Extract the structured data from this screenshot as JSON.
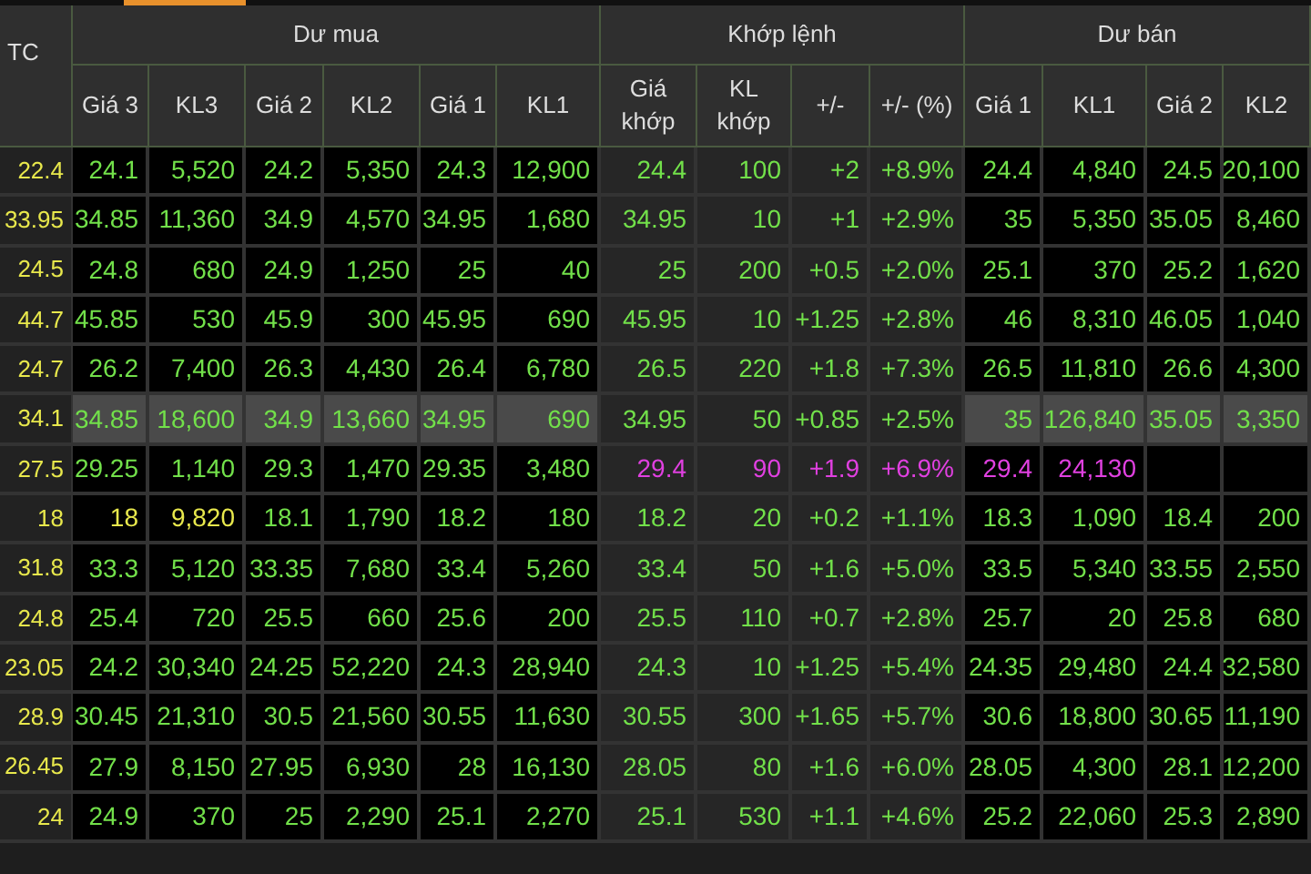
{
  "tc_header": "TC",
  "groups": [
    {
      "label": "Dư mua",
      "columns": [
        "Giá 3",
        "KL3",
        "Giá 2",
        "KL2",
        "Giá 1",
        "KL1"
      ]
    },
    {
      "label": "Khớp lệnh",
      "columns": [
        "Giá khớp",
        "KL khớp",
        "+/-",
        "+/- (%)"
      ]
    },
    {
      "label": "Dư bán",
      "columns": [
        "Giá 1",
        "KL1",
        "Giá 2",
        "KL2"
      ]
    }
  ],
  "rows": [
    {
      "tc": "22.4",
      "selected": false,
      "cells": [
        {
          "text": "24.1",
          "color": "#72e04a"
        },
        {
          "text": "5,520",
          "color": "#72e04a"
        },
        {
          "text": "24.2",
          "color": "#72e04a"
        },
        {
          "text": "5,350",
          "color": "#72e04a"
        },
        {
          "text": "24.3",
          "color": "#72e04a"
        },
        {
          "text": "12,900",
          "color": "#72e04a"
        },
        {
          "text": "24.4",
          "color": "#72e04a"
        },
        {
          "text": "100",
          "color": "#72e04a"
        },
        {
          "text": "+2",
          "color": "#72e04a"
        },
        {
          "text": "+8.9%",
          "color": "#72e04a"
        },
        {
          "text": "24.4",
          "color": "#72e04a"
        },
        {
          "text": "4,840",
          "color": "#72e04a"
        },
        {
          "text": "24.5",
          "color": "#72e04a"
        },
        {
          "text": "20,100",
          "color": "#72e04a"
        }
      ]
    },
    {
      "tc": "33.95",
      "selected": false,
      "cells": [
        {
          "text": "34.85",
          "color": "#72e04a"
        },
        {
          "text": "11,360",
          "color": "#72e04a"
        },
        {
          "text": "34.9",
          "color": "#72e04a"
        },
        {
          "text": "4,570",
          "color": "#72e04a"
        },
        {
          "text": "34.95",
          "color": "#72e04a"
        },
        {
          "text": "1,680",
          "color": "#72e04a"
        },
        {
          "text": "34.95",
          "color": "#72e04a"
        },
        {
          "text": "10",
          "color": "#72e04a"
        },
        {
          "text": "+1",
          "color": "#72e04a"
        },
        {
          "text": "+2.9%",
          "color": "#72e04a"
        },
        {
          "text": "35",
          "color": "#72e04a"
        },
        {
          "text": "5,350",
          "color": "#72e04a"
        },
        {
          "text": "35.05",
          "color": "#72e04a"
        },
        {
          "text": "8,460",
          "color": "#72e04a"
        }
      ]
    },
    {
      "tc": "24.5",
      "selected": false,
      "cells": [
        {
          "text": "24.8",
          "color": "#72e04a"
        },
        {
          "text": "680",
          "color": "#72e04a"
        },
        {
          "text": "24.9",
          "color": "#72e04a"
        },
        {
          "text": "1,250",
          "color": "#72e04a"
        },
        {
          "text": "25",
          "color": "#72e04a"
        },
        {
          "text": "40",
          "color": "#72e04a"
        },
        {
          "text": "25",
          "color": "#72e04a"
        },
        {
          "text": "200",
          "color": "#72e04a"
        },
        {
          "text": "+0.5",
          "color": "#72e04a"
        },
        {
          "text": "+2.0%",
          "color": "#72e04a"
        },
        {
          "text": "25.1",
          "color": "#72e04a"
        },
        {
          "text": "370",
          "color": "#72e04a"
        },
        {
          "text": "25.2",
          "color": "#72e04a"
        },
        {
          "text": "1,620",
          "color": "#72e04a"
        }
      ]
    },
    {
      "tc": "44.7",
      "selected": false,
      "cells": [
        {
          "text": "45.85",
          "color": "#72e04a"
        },
        {
          "text": "530",
          "color": "#72e04a"
        },
        {
          "text": "45.9",
          "color": "#72e04a"
        },
        {
          "text": "300",
          "color": "#72e04a"
        },
        {
          "text": "45.95",
          "color": "#72e04a"
        },
        {
          "text": "690",
          "color": "#72e04a"
        },
        {
          "text": "45.95",
          "color": "#72e04a"
        },
        {
          "text": "10",
          "color": "#72e04a"
        },
        {
          "text": "+1.25",
          "color": "#72e04a"
        },
        {
          "text": "+2.8%",
          "color": "#72e04a"
        },
        {
          "text": "46",
          "color": "#72e04a"
        },
        {
          "text": "8,310",
          "color": "#72e04a"
        },
        {
          "text": "46.05",
          "color": "#72e04a"
        },
        {
          "text": "1,040",
          "color": "#72e04a"
        }
      ]
    },
    {
      "tc": "24.7",
      "selected": false,
      "cells": [
        {
          "text": "26.2",
          "color": "#72e04a"
        },
        {
          "text": "7,400",
          "color": "#72e04a"
        },
        {
          "text": "26.3",
          "color": "#72e04a"
        },
        {
          "text": "4,430",
          "color": "#72e04a"
        },
        {
          "text": "26.4",
          "color": "#72e04a"
        },
        {
          "text": "6,780",
          "color": "#72e04a"
        },
        {
          "text": "26.5",
          "color": "#72e04a"
        },
        {
          "text": "220",
          "color": "#72e04a"
        },
        {
          "text": "+1.8",
          "color": "#72e04a"
        },
        {
          "text": "+7.3%",
          "color": "#72e04a"
        },
        {
          "text": "26.5",
          "color": "#72e04a"
        },
        {
          "text": "11,810",
          "color": "#72e04a"
        },
        {
          "text": "26.6",
          "color": "#72e04a"
        },
        {
          "text": "4,300",
          "color": "#72e04a"
        }
      ]
    },
    {
      "tc": "34.1",
      "selected": true,
      "cells": [
        {
          "text": "34.85",
          "color": "#72e04a"
        },
        {
          "text": "18,600",
          "color": "#72e04a"
        },
        {
          "text": "34.9",
          "color": "#72e04a"
        },
        {
          "text": "13,660",
          "color": "#72e04a"
        },
        {
          "text": "34.95",
          "color": "#72e04a"
        },
        {
          "text": "690",
          "color": "#72e04a"
        },
        {
          "text": "34.95",
          "color": "#72e04a"
        },
        {
          "text": "50",
          "color": "#72e04a"
        },
        {
          "text": "+0.85",
          "color": "#72e04a"
        },
        {
          "text": "+2.5%",
          "color": "#72e04a"
        },
        {
          "text": "35",
          "color": "#72e04a"
        },
        {
          "text": "126,840",
          "color": "#72e04a"
        },
        {
          "text": "35.05",
          "color": "#72e04a"
        },
        {
          "text": "3,350",
          "color": "#72e04a"
        }
      ]
    },
    {
      "tc": "27.5",
      "selected": false,
      "cells": [
        {
          "text": "29.25",
          "color": "#72e04a"
        },
        {
          "text": "1,140",
          "color": "#72e04a"
        },
        {
          "text": "29.3",
          "color": "#72e04a"
        },
        {
          "text": "1,470",
          "color": "#72e04a"
        },
        {
          "text": "29.35",
          "color": "#72e04a"
        },
        {
          "text": "3,480",
          "color": "#72e04a"
        },
        {
          "text": "29.4",
          "color": "#e040e0"
        },
        {
          "text": "90",
          "color": "#e040e0"
        },
        {
          "text": "+1.9",
          "color": "#e040e0"
        },
        {
          "text": "+6.9%",
          "color": "#e040e0"
        },
        {
          "text": "29.4",
          "color": "#e040e0"
        },
        {
          "text": "24,130",
          "color": "#e040e0"
        }
      ]
    },
    {
      "tc": "18",
      "selected": false,
      "cells": [
        {
          "text": "18",
          "color": "#e8e84c"
        },
        {
          "text": "9,820",
          "color": "#e8e84c"
        },
        {
          "text": "18.1",
          "color": "#72e04a"
        },
        {
          "text": "1,790",
          "color": "#72e04a"
        },
        {
          "text": "18.2",
          "color": "#72e04a"
        },
        {
          "text": "180",
          "color": "#72e04a"
        },
        {
          "text": "18.2",
          "color": "#72e04a"
        },
        {
          "text": "20",
          "color": "#72e04a"
        },
        {
          "text": "+0.2",
          "color": "#72e04a"
        },
        {
          "text": "+1.1%",
          "color": "#72e04a"
        },
        {
          "text": "18.3",
          "color": "#72e04a"
        },
        {
          "text": "1,090",
          "color": "#72e04a"
        },
        {
          "text": "18.4",
          "color": "#72e04a"
        },
        {
          "text": "200",
          "color": "#72e04a"
        }
      ]
    },
    {
      "tc": "31.8",
      "selected": false,
      "cells": [
        {
          "text": "33.3",
          "color": "#72e04a"
        },
        {
          "text": "5,120",
          "color": "#72e04a"
        },
        {
          "text": "33.35",
          "color": "#72e04a"
        },
        {
          "text": "7,680",
          "color": "#72e04a"
        },
        {
          "text": "33.4",
          "color": "#72e04a"
        },
        {
          "text": "5,260",
          "color": "#72e04a"
        },
        {
          "text": "33.4",
          "color": "#72e04a"
        },
        {
          "text": "50",
          "color": "#72e04a"
        },
        {
          "text": "+1.6",
          "color": "#72e04a"
        },
        {
          "text": "+5.0%",
          "color": "#72e04a"
        },
        {
          "text": "33.5",
          "color": "#72e04a"
        },
        {
          "text": "5,340",
          "color": "#72e04a"
        },
        {
          "text": "33.55",
          "color": "#72e04a"
        },
        {
          "text": "2,550",
          "color": "#72e04a"
        }
      ]
    },
    {
      "tc": "24.8",
      "selected": false,
      "cells": [
        {
          "text": "25.4",
          "color": "#72e04a"
        },
        {
          "text": "720",
          "color": "#72e04a"
        },
        {
          "text": "25.5",
          "color": "#72e04a"
        },
        {
          "text": "660",
          "color": "#72e04a"
        },
        {
          "text": "25.6",
          "color": "#72e04a"
        },
        {
          "text": "200",
          "color": "#72e04a"
        },
        {
          "text": "25.5",
          "color": "#72e04a"
        },
        {
          "text": "110",
          "color": "#72e04a"
        },
        {
          "text": "+0.7",
          "color": "#72e04a"
        },
        {
          "text": "+2.8%",
          "color": "#72e04a"
        },
        {
          "text": "25.7",
          "color": "#72e04a"
        },
        {
          "text": "20",
          "color": "#72e04a"
        },
        {
          "text": "25.8",
          "color": "#72e04a"
        },
        {
          "text": "680",
          "color": "#72e04a"
        }
      ]
    },
    {
      "tc": "23.05",
      "selected": false,
      "cells": [
        {
          "text": "24.2",
          "color": "#72e04a"
        },
        {
          "text": "30,340",
          "color": "#72e04a"
        },
        {
          "text": "24.25",
          "color": "#72e04a"
        },
        {
          "text": "52,220",
          "color": "#72e04a"
        },
        {
          "text": "24.3",
          "color": "#72e04a"
        },
        {
          "text": "28,940",
          "color": "#72e04a"
        },
        {
          "text": "24.3",
          "color": "#72e04a"
        },
        {
          "text": "10",
          "color": "#72e04a"
        },
        {
          "text": "+1.25",
          "color": "#72e04a"
        },
        {
          "text": "+5.4%",
          "color": "#72e04a"
        },
        {
          "text": "24.35",
          "color": "#72e04a"
        },
        {
          "text": "29,480",
          "color": "#72e04a"
        },
        {
          "text": "24.4",
          "color": "#72e04a"
        },
        {
          "text": "32,580",
          "color": "#72e04a"
        }
      ]
    },
    {
      "tc": "28.9",
      "selected": false,
      "cells": [
        {
          "text": "30.45",
          "color": "#72e04a"
        },
        {
          "text": "21,310",
          "color": "#72e04a"
        },
        {
          "text": "30.5",
          "color": "#72e04a"
        },
        {
          "text": "21,560",
          "color": "#72e04a"
        },
        {
          "text": "30.55",
          "color": "#72e04a"
        },
        {
          "text": "11,630",
          "color": "#72e04a"
        },
        {
          "text": "30.55",
          "color": "#72e04a"
        },
        {
          "text": "300",
          "color": "#72e04a"
        },
        {
          "text": "+1.65",
          "color": "#72e04a"
        },
        {
          "text": "+5.7%",
          "color": "#72e04a"
        },
        {
          "text": "30.6",
          "color": "#72e04a"
        },
        {
          "text": "18,800",
          "color": "#72e04a"
        },
        {
          "text": "30.65",
          "color": "#72e04a"
        },
        {
          "text": "11,190",
          "color": "#72e04a"
        }
      ]
    },
    {
      "tc": "26.45",
      "selected": false,
      "cells": [
        {
          "text": "27.9",
          "color": "#72e04a"
        },
        {
          "text": "8,150",
          "color": "#72e04a"
        },
        {
          "text": "27.95",
          "color": "#72e04a"
        },
        {
          "text": "6,930",
          "color": "#72e04a"
        },
        {
          "text": "28",
          "color": "#72e04a"
        },
        {
          "text": "16,130",
          "color": "#72e04a"
        },
        {
          "text": "28.05",
          "color": "#72e04a"
        },
        {
          "text": "80",
          "color": "#72e04a"
        },
        {
          "text": "+1.6",
          "color": "#72e04a"
        },
        {
          "text": "+6.0%",
          "color": "#72e04a"
        },
        {
          "text": "28.05",
          "color": "#72e04a"
        },
        {
          "text": "4,300",
          "color": "#72e04a"
        },
        {
          "text": "28.1",
          "color": "#72e04a"
        },
        {
          "text": "12,200",
          "color": "#72e04a"
        }
      ]
    },
    {
      "tc": "24",
      "selected": false,
      "cells": [
        {
          "text": "24.9",
          "color": "#72e04a"
        },
        {
          "text": "370",
          "color": "#72e04a"
        },
        {
          "text": "25",
          "color": "#72e04a"
        },
        {
          "text": "2,290",
          "color": "#72e04a"
        },
        {
          "text": "25.1",
          "color": "#72e04a"
        },
        {
          "text": "2,270",
          "color": "#72e04a"
        },
        {
          "text": "25.1",
          "color": "#72e04a"
        },
        {
          "text": "530",
          "color": "#72e04a"
        },
        {
          "text": "+1.1",
          "color": "#72e04a"
        },
        {
          "text": "+4.6%",
          "color": "#72e04a"
        },
        {
          "text": "25.2",
          "color": "#72e04a"
        },
        {
          "text": "22,060",
          "color": "#72e04a"
        },
        {
          "text": "25.3",
          "color": "#72e04a"
        },
        {
          "text": "2,890",
          "color": "#72e04a"
        }
      ]
    }
  ]
}
